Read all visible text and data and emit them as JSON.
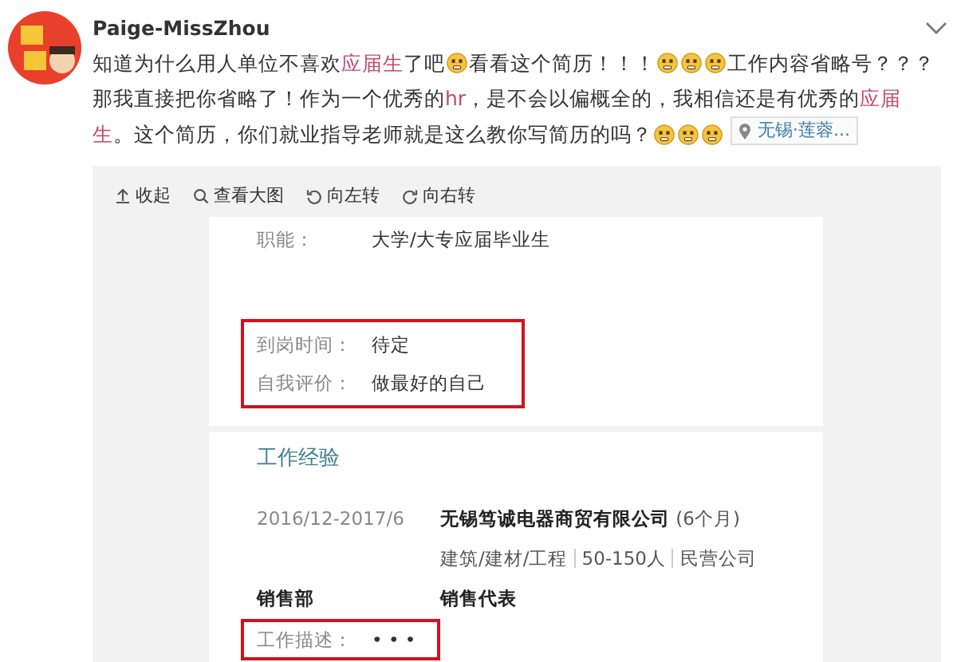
{
  "post": {
    "author": "Paige-MissZhou",
    "segments": [
      {
        "kind": "text",
        "text": "知道为什么用人单位不喜欢",
        "highlight": false
      },
      {
        "kind": "text",
        "text": "应届生",
        "highlight": true
      },
      {
        "kind": "text",
        "text": "了吧",
        "highlight": false
      },
      {
        "kind": "emoji"
      },
      {
        "kind": "text",
        "text": "看看这个简历！！！",
        "highlight": false
      },
      {
        "kind": "emoji"
      },
      {
        "kind": "emoji"
      },
      {
        "kind": "emoji"
      },
      {
        "kind": "text",
        "text": "工作内容省略号？？？那我直接把你省略了！作为一个优秀的",
        "highlight": false
      },
      {
        "kind": "text",
        "text": "hr",
        "highlight": true
      },
      {
        "kind": "text",
        "text": "，是不会以偏概全的，我相信还是有优秀的",
        "highlight": false
      },
      {
        "kind": "text",
        "text": "应届生",
        "highlight": true
      },
      {
        "kind": "text",
        "text": "。这个简历，你们就业指导老师就是这么教你写简历的吗？",
        "highlight": false
      },
      {
        "kind": "emoji"
      },
      {
        "kind": "emoji"
      },
      {
        "kind": "emoji"
      },
      {
        "kind": "location",
        "text": "无锡·莲蓉..."
      }
    ]
  },
  "media": {
    "toolbar": [
      {
        "kind": "collapse",
        "label": "收起"
      },
      {
        "kind": "zoom",
        "label": "查看大图"
      },
      {
        "kind": "rotate_left",
        "label": "向左转"
      },
      {
        "kind": "rotate_right",
        "label": "向右转"
      }
    ],
    "resume": {
      "fields": [
        {
          "label": "职能：",
          "value": "大学/大专应届毕业生"
        }
      ],
      "marked_fields": [
        {
          "label": "到岗时间：",
          "value": "待定"
        },
        {
          "label": "自我评价：",
          "value": "做最好的自己"
        }
      ],
      "experience": {
        "title": "工作经验",
        "period": "2016/12-2017/6",
        "company": "无锡笃诚电器商贸有限公司",
        "duration": "(6个月)",
        "details": [
          "建筑/建材/工程",
          "50-150人",
          "民营公司"
        ],
        "department": "销售部",
        "position": "销售代表",
        "description": {
          "label": "工作描述：",
          "value": "• • •",
          "marked": true
        }
      }
    }
  }
}
